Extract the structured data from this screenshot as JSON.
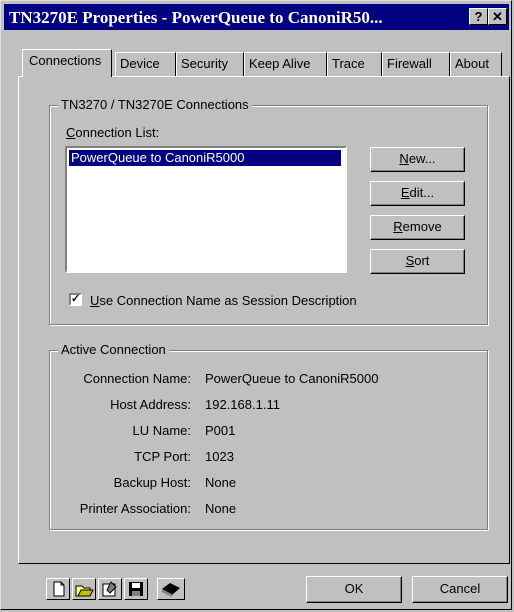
{
  "window": {
    "title": "TN3270E Properties - PowerQueue to CanoniR50...",
    "help_label": "?",
    "close_label": "✕"
  },
  "tabs": [
    "Connections",
    "Device",
    "Security",
    "Keep Alive",
    "Trace",
    "Firewall",
    "About"
  ],
  "connections_group": {
    "title": "TN3270 / TN3270E Connections",
    "list_label_first": "C",
    "list_label_rest": "onnection List:",
    "items": [
      "PowerQueue to CanoniR5000"
    ],
    "buttons": {
      "new_u": "N",
      "new_rest": "ew...",
      "edit_u": "E",
      "edit_rest": "dit...",
      "remove_u": "R",
      "remove_rest": "emove",
      "sort_u": "S",
      "sort_rest": "ort"
    },
    "checkbox_u": "U",
    "checkbox_rest": "se Connection Name as Session Description",
    "checkbox_checked": true
  },
  "active_group": {
    "title": "Active Connection",
    "fields": [
      {
        "label": "Connection Name:",
        "value": "PowerQueue to CanoniR5000"
      },
      {
        "label": "Host Address:",
        "value": "192.168.1.11"
      },
      {
        "label": "LU Name:",
        "value": "P001"
      },
      {
        "label": "TCP Port:",
        "value": "1023"
      },
      {
        "label": "Backup Host:",
        "value": "None"
      },
      {
        "label": "Printer Association:",
        "value": "None"
      }
    ]
  },
  "footer": {
    "ok_label": "OK",
    "cancel_label": "Cancel"
  },
  "toolbar_icons": [
    "new-file-icon",
    "open-folder-icon",
    "properties-icon",
    "save-icon",
    "book-icon"
  ]
}
